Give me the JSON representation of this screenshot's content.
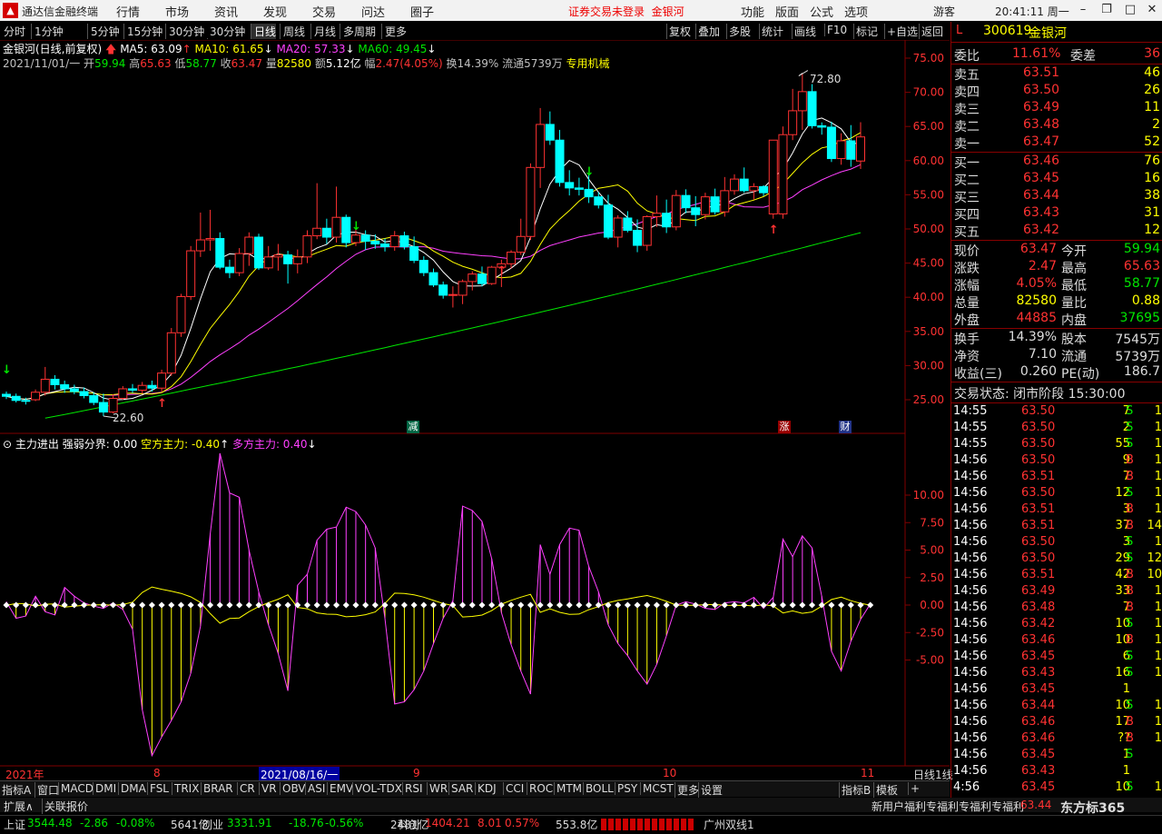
{
  "window": {
    "app_title": "通达信金融终端",
    "menu": [
      "行情",
      "市场",
      "资讯",
      "发现",
      "交易",
      "问达",
      "圈子"
    ],
    "warning": "证券交易未登录",
    "warning_stock": "金银河",
    "right_menu": [
      "功能",
      "版面",
      "公式",
      "选项"
    ],
    "user": "游客",
    "clock": "20:41:11 周一"
  },
  "periods": [
    "分时",
    "1分钟",
    "5分钟",
    "15分钟",
    "30分钟",
    "日线",
    "周线",
    "月线",
    "多周期",
    "更多"
  ],
  "active_period": "日线",
  "chart_tools": [
    "复权",
    "叠加",
    "多股",
    "统计",
    "画线",
    "F10",
    "标记",
    "+自选",
    "返回"
  ],
  "kline_header": {
    "name": "金银河(日线,前复权)",
    "ma5": "MA5: 63.09",
    "ma10": "MA10: 61.65",
    "ma20": "MA20: 57.33",
    "ma60": "MA60: 49.45"
  },
  "kline_info": {
    "date": "2021/11/01/一",
    "open_l": "开",
    "open": "59.94",
    "high_l": "高",
    "high": "65.63",
    "low_l": "低",
    "low": "58.77",
    "close_l": "收",
    "close": "63.47",
    "vol_l": "量",
    "vol": "82580",
    "amt_l": "额",
    "amt": "5.12亿",
    "chg_l": "幅",
    "chg": "2.47(4.05%)",
    "turn": "换14.39%",
    "float": "流通5739万",
    "sector": "专用机械"
  },
  "price_axis": [
    "75.00",
    "70.00",
    "65.00",
    "60.00",
    "55.00",
    "50.00",
    "45.00",
    "40.00",
    "35.00",
    "30.00",
    "25.00"
  ],
  "chart_marks": {
    "max": "72.80",
    "min": "22.60",
    "jian": "减",
    "zhang": "涨",
    "cai": "财"
  },
  "indicator": {
    "title": "主力进出",
    "label1": "强弱分界: 0.00",
    "label2": "空方主力: -0.40",
    "label3": "多方主力: 0.40",
    "axis": [
      "10.00",
      "7.50",
      "5.00",
      "2.50",
      "0.00",
      "-2.50",
      "-5.00"
    ]
  },
  "date_axis": {
    "d1": "2021年",
    "d2": "8",
    "d3": "2021/08/16/一",
    "d4": "9",
    "d5": "10",
    "d6": "11",
    "label": "日线1线"
  },
  "quote": {
    "code": "300619",
    "name": "金银河",
    "flag": "L",
    "webi_l": "委比",
    "webi": "11.61%",
    "weicha_l": "委差",
    "weicha": "36",
    "sell": [
      {
        "l": "卖五",
        "p": "63.51",
        "v": "46"
      },
      {
        "l": "卖四",
        "p": "63.50",
        "v": "26"
      },
      {
        "l": "卖三",
        "p": "63.49",
        "v": "11"
      },
      {
        "l": "卖二",
        "p": "63.48",
        "v": "2"
      },
      {
        "l": "卖一",
        "p": "63.47",
        "v": "52"
      }
    ],
    "buy": [
      {
        "l": "买一",
        "p": "63.46",
        "v": "76"
      },
      {
        "l": "买二",
        "p": "63.45",
        "v": "16"
      },
      {
        "l": "买三",
        "p": "63.44",
        "v": "38"
      },
      {
        "l": "买四",
        "p": "63.43",
        "v": "31"
      },
      {
        "l": "买五",
        "p": "63.42",
        "v": "12"
      }
    ],
    "stats": [
      {
        "l1": "现价",
        "v1": "63.47",
        "c1": "red",
        "l2": "今开",
        "v2": "59.94",
        "c2": "green"
      },
      {
        "l1": "涨跌",
        "v1": "2.47",
        "c1": "red",
        "l2": "最高",
        "v2": "65.63",
        "c2": "red"
      },
      {
        "l1": "涨幅",
        "v1": "4.05%",
        "c1": "red",
        "l2": "最低",
        "v2": "58.77",
        "c2": "green"
      },
      {
        "l1": "总量",
        "v1": "82580",
        "c1": "yellow",
        "l2": "量比",
        "v2": "0.88",
        "c2": "yellow"
      },
      {
        "l1": "外盘",
        "v1": "44885",
        "c1": "red",
        "l2": "内盘",
        "v2": "37695",
        "c2": "green"
      }
    ],
    "stats2": [
      {
        "l1": "换手",
        "v1": "14.39%",
        "l2": "股本",
        "v2": "7545万"
      },
      {
        "l1": "净资",
        "v1": "7.10",
        "l2": "流通",
        "v2": "5739万"
      },
      {
        "l1": "收益(三)",
        "v1": "0.260",
        "l2": "PE(动)",
        "v2": "186.7"
      }
    ],
    "trade_state": "交易状态: 闭市阶段 15:30:00"
  },
  "ticks": [
    [
      "14:55",
      "63.50",
      "7",
      "S",
      "1"
    ],
    [
      "14:55",
      "63.50",
      "2",
      "S",
      "1"
    ],
    [
      "14:55",
      "63.50",
      "55",
      "S",
      "1"
    ],
    [
      "14:56",
      "63.50",
      "9",
      "B",
      "1"
    ],
    [
      "14:56",
      "63.51",
      "7",
      "B",
      "1"
    ],
    [
      "14:56",
      "63.50",
      "12",
      "S",
      "1"
    ],
    [
      "14:56",
      "63.51",
      "3",
      "B",
      "1"
    ],
    [
      "14:56",
      "63.51",
      "37",
      "B",
      "14"
    ],
    [
      "14:56",
      "63.50",
      "3",
      "S",
      "1"
    ],
    [
      "14:56",
      "63.50",
      "29",
      "S",
      "12"
    ],
    [
      "14:56",
      "63.51",
      "42",
      "B",
      "10"
    ],
    [
      "14:56",
      "63.49",
      "33",
      "B",
      "1"
    ],
    [
      "14:56",
      "63.48",
      "7",
      "B",
      "1"
    ],
    [
      "14:56",
      "63.42",
      "10",
      "S",
      "1"
    ],
    [
      "14:56",
      "63.46",
      "10",
      "B",
      "1"
    ],
    [
      "14:56",
      "63.45",
      "6",
      "S",
      "1"
    ],
    [
      "14:56",
      "63.43",
      "16",
      "S",
      "1"
    ],
    [
      "14:56",
      "63.45",
      "1",
      "",
      ""
    ],
    [
      "14:56",
      "63.44",
      "10",
      "S",
      "1"
    ],
    [
      "14:56",
      "63.46",
      "17",
      "B",
      "1"
    ],
    [
      "14:56",
      "63.46",
      "??",
      "B",
      "1"
    ],
    [
      "14:56",
      "63.45",
      "1",
      "S",
      ""
    ],
    [
      "14:56",
      "63.43",
      "1",
      "",
      ""
    ],
    [
      "4:56",
      "63.45",
      "10",
      "S",
      "1"
    ]
  ],
  "indicator_tabs": [
    "指标A",
    "窗口",
    "MACD",
    "DMI",
    "DMA",
    "FSL",
    "TRIX",
    "BRAR",
    "CR",
    "VR",
    "OBV",
    "ASI",
    "EMV",
    "VOL-TDX",
    "RSI",
    "WR",
    "SAR",
    "KDJ",
    "CCI",
    "ROC",
    "MTM",
    "BOLL",
    "PSY",
    "MCST",
    "更多",
    "设置"
  ],
  "right_tabs": [
    "指标B",
    "模板",
    "+"
  ],
  "bottom_links": [
    "扩展∧",
    "关联报价"
  ],
  "news_ticker": "新用户福利专福利专福利专福利",
  "last_price": "63.44",
  "market": [
    {
      "name": "上证",
      "val": "3544.48",
      "chg": "-2.86",
      "pct": "-0.08%",
      "amt": "5641亿"
    },
    {
      "name": "创业",
      "val": "3331.91",
      "chg": "-18.76",
      "pct": "-0.56%",
      "amt": "2481亿"
    },
    {
      "name": "科创",
      "val": "1404.21",
      "chg": "8.01",
      "pct": "0.57%",
      "amt": "553.8亿"
    }
  ],
  "board_name": "广州双线1",
  "logo_text": "东方标365",
  "colors": {
    "up": "#ff3232",
    "down": "#00ffff",
    "ma5": "#ffffff",
    "ma10": "#ffff00",
    "ma20": "#ff40ff",
    "ma60": "#00e600",
    "grid": "#800000"
  }
}
